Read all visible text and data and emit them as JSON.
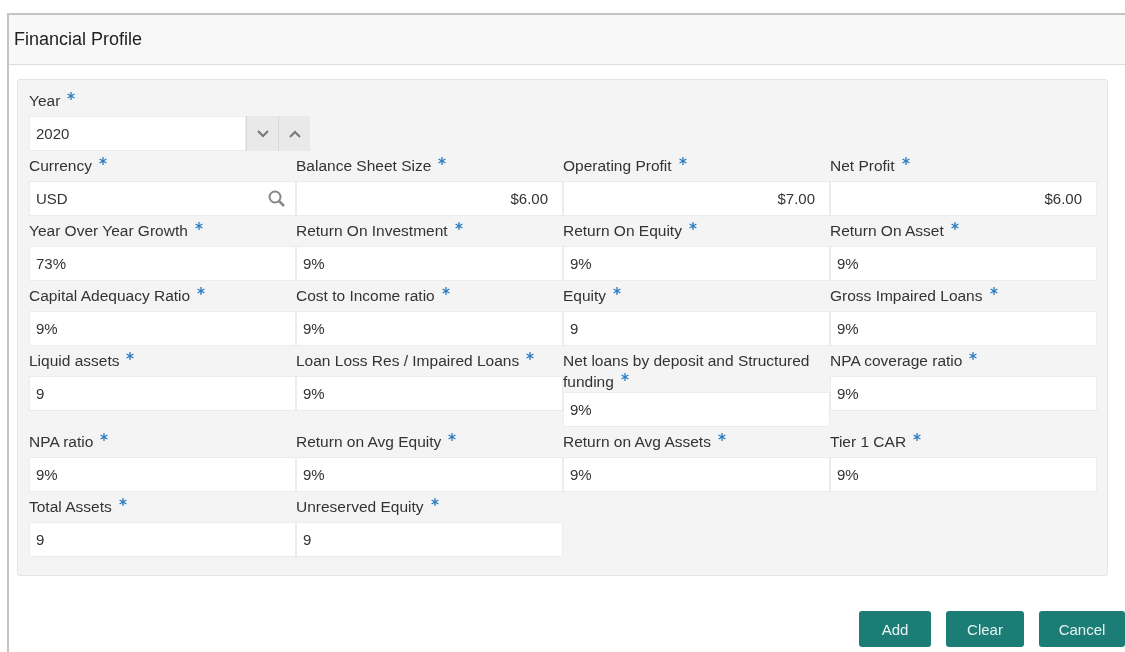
{
  "title": "Financial Profile",
  "fields": [
    {
      "label": "Year",
      "required": true,
      "kind": "spinner",
      "value": "2020"
    },
    {
      "label": "Currency",
      "required": true,
      "kind": "lookup",
      "value": "USD"
    },
    {
      "label": "Balance Sheet Size",
      "required": true,
      "kind": "amount",
      "value": "$6.00"
    },
    {
      "label": "Operating Profit",
      "required": true,
      "kind": "amount",
      "value": "$7.00"
    },
    {
      "label": "Net Profit",
      "required": true,
      "kind": "amount",
      "value": "$6.00"
    },
    {
      "label": "Year Over Year Growth",
      "required": true,
      "kind": "text",
      "value": "73%"
    },
    {
      "label": "Return On Investment",
      "required": true,
      "kind": "text",
      "value": "9%"
    },
    {
      "label": "Return On Equity",
      "required": true,
      "kind": "text",
      "value": "9%"
    },
    {
      "label": "Return On Asset",
      "required": true,
      "kind": "text",
      "value": "9%"
    },
    {
      "label": "Capital Adequacy Ratio",
      "required": true,
      "kind": "text",
      "value": "9%"
    },
    {
      "label": "Cost to Income ratio",
      "required": true,
      "kind": "text",
      "value": "9%"
    },
    {
      "label": "Equity",
      "required": true,
      "kind": "text",
      "value": "9"
    },
    {
      "label": "Gross Impaired Loans",
      "required": true,
      "kind": "text",
      "value": "9%"
    },
    {
      "label": "Liquid assets",
      "required": true,
      "kind": "text",
      "value": "9"
    },
    {
      "label": "Loan Loss Res / Impaired Loans",
      "required": true,
      "kind": "text",
      "value": "9%"
    },
    {
      "label": "Net loans by deposit and Structured funding",
      "required": true,
      "kind": "text",
      "value": "9%"
    },
    {
      "label": "NPA coverage ratio",
      "required": true,
      "kind": "text",
      "value": "9%"
    },
    {
      "label": "NPA ratio",
      "required": true,
      "kind": "text",
      "value": "9%"
    },
    {
      "label": "Return on Avg Equity",
      "required": true,
      "kind": "text",
      "value": "9%"
    },
    {
      "label": "Return on Avg Assets",
      "required": true,
      "kind": "text",
      "value": "9%"
    },
    {
      "label": "Tier 1 CAR",
      "required": true,
      "kind": "text",
      "value": "9%"
    },
    {
      "label": "Total Assets",
      "required": true,
      "kind": "text",
      "value": "9"
    },
    {
      "label": "Unreserved Equity",
      "required": true,
      "kind": "text",
      "value": "9"
    }
  ],
  "buttons": [
    "Add",
    "Clear",
    "Cancel"
  ]
}
